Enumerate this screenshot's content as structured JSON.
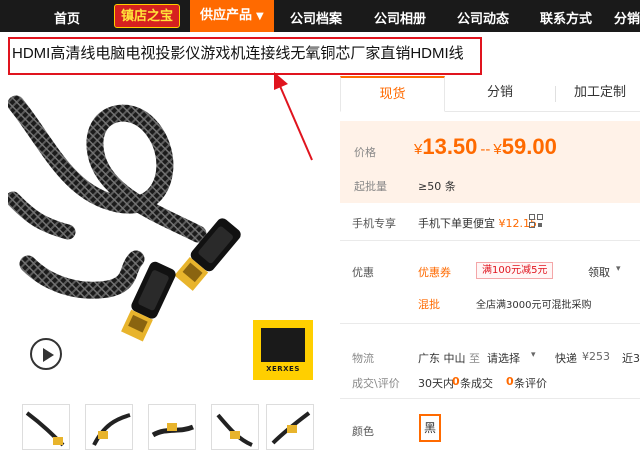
{
  "nav": {
    "items": [
      "首页",
      "供应产品",
      "公司档案",
      "公司相册",
      "公司动态",
      "联系方式",
      "分销"
    ],
    "badge": "镇店之宝"
  },
  "product": {
    "title": "HDMI高清线电脑电视投影仪游戏机连接线无氧铜芯厂家直销HDMI线",
    "logo_text": "XERXES"
  },
  "tabs": [
    "现货",
    "分销",
    "加工定制"
  ],
  "price": {
    "label": "价格",
    "currency": "¥",
    "low": "13.50",
    "separator": "--",
    "high": "59.00",
    "moq_label": "起批量",
    "moq_value": "≥50 条"
  },
  "mobile": {
    "label": "手机专享",
    "text": "手机下单更便宜",
    "amount": "¥12.15"
  },
  "promo": {
    "label": "优惠",
    "coupon_label": "优惠券",
    "coupon_badge": "满100元减5元",
    "claim": "领取",
    "mix_label": "混批",
    "mix_text": "全店满3000元可混批采购"
  },
  "logistics": {
    "label": "物流",
    "origin": "广东 中山",
    "to": "至",
    "select": "请选择",
    "express": "快递",
    "express_price": "¥253",
    "cutoff": "近3"
  },
  "deals": {
    "label": "成交\\评价",
    "period": "30天内",
    "deals_count": "0",
    "deals_text": "条成交",
    "review_count": "0",
    "review_text": "条评价"
  },
  "color": {
    "label": "颜色",
    "option": "黑"
  },
  "colors": {
    "accent": "#ff6a00",
    "nav_bg": "#1a1a1a",
    "highlight_red": "#e0141e",
    "price_bg": "#fff2e8"
  }
}
